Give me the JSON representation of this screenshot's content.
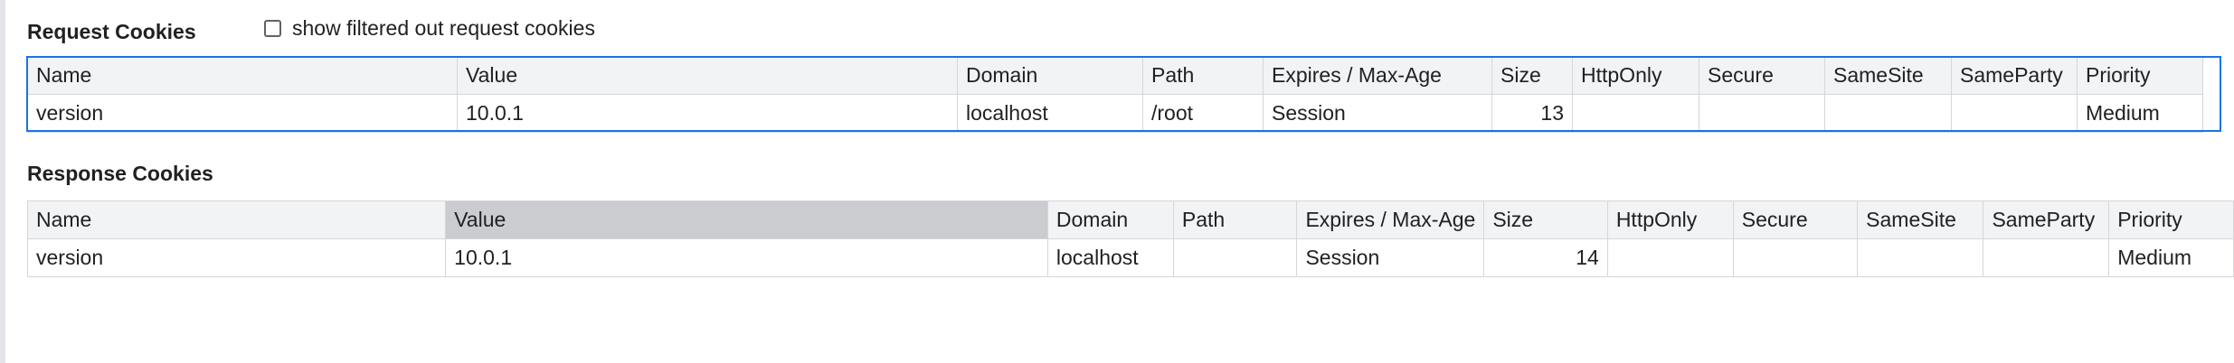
{
  "request": {
    "title": "Request Cookies",
    "filter_label": "show filtered out request cookies",
    "columns": [
      "Name",
      "Value",
      "Domain",
      "Path",
      "Expires / Max-Age",
      "Size",
      "HttpOnly",
      "Secure",
      "SameSite",
      "SameParty",
      "Priority"
    ],
    "rows": [
      [
        "version",
        "10.0.1",
        "localhost",
        "/root",
        "Session",
        "13",
        "",
        "",
        "",
        "",
        "Medium"
      ]
    ]
  },
  "response": {
    "title": "Response Cookies",
    "columns": [
      "Name",
      "Value",
      "Domain",
      "Path",
      "Expires / Max-Age",
      "Size",
      "HttpOnly",
      "Secure",
      "SameSite",
      "SameParty",
      "Priority"
    ],
    "rows": [
      [
        "version",
        "10.0.1",
        "localhost",
        "",
        "Session",
        "14",
        "",
        "",
        "",
        "",
        "Medium"
      ]
    ]
  },
  "colors": {
    "selection_border": "#1a73e8",
    "header_bg": "#f1f3f4",
    "sorted_header_bg": "#caccd0",
    "grid_line": "#d5d7da"
  }
}
